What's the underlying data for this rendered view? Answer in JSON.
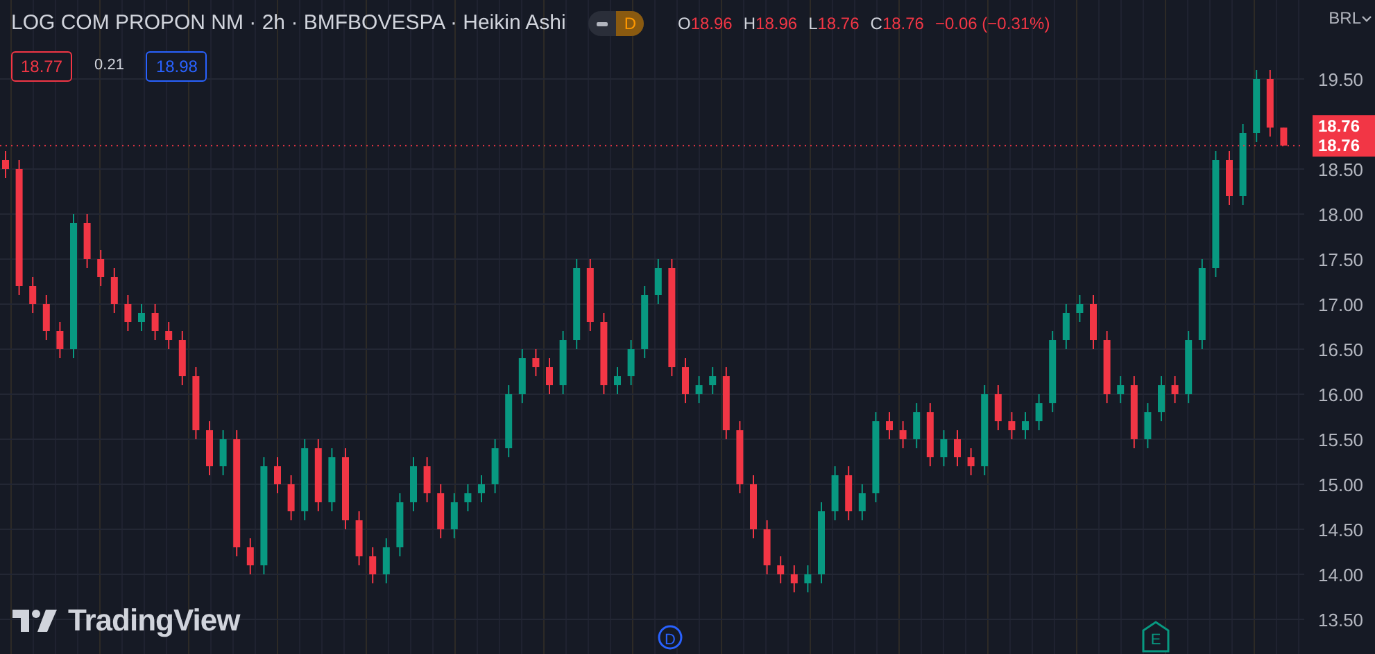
{
  "header": {
    "title": "LOG COM PROPON NM · 2h · BMFBOVESPA · Heikin Ashi",
    "badge": "D",
    "ohlc": [
      {
        "label": "O",
        "value": "18.96"
      },
      {
        "label": "H",
        "value": "18.96"
      },
      {
        "label": "L",
        "value": "18.76"
      },
      {
        "label": "C",
        "value": "18.76"
      }
    ],
    "change": "−0.06 (−0.31%)"
  },
  "trade": {
    "sell": "18.77",
    "spread": "0.21",
    "buy": "18.98"
  },
  "currency": "BRL",
  "price_labels": [
    "18.76"
  ],
  "logo": "TradingView",
  "events": [
    {
      "kind": "dividend",
      "label": "D",
      "color": "#2962ff"
    },
    {
      "kind": "earnings",
      "label": "E",
      "color": "#089981"
    }
  ],
  "chart_data": {
    "type": "candlestick",
    "grid": true,
    "yticks": [
      {
        "value": 13.5,
        "label": "13.50"
      },
      {
        "value": 14,
        "label": "14.00"
      },
      {
        "value": 14.5,
        "label": "14.50"
      },
      {
        "value": 15,
        "label": "15.00"
      },
      {
        "value": 15.5,
        "label": "15.50"
      },
      {
        "value": 16,
        "label": "16.00"
      },
      {
        "value": 16.5,
        "label": "16.50"
      },
      {
        "value": 17,
        "label": "17.00"
      },
      {
        "value": 17.5,
        "label": "17.50"
      },
      {
        "value": 18,
        "label": "18.00"
      },
      {
        "value": 18.5,
        "label": "18.50"
      },
      {
        "value": 19.5,
        "label": "19.50"
      }
    ],
    "ylim": [
      13.5,
      19.5
    ],
    "ref_lines": [
      {
        "axis": "y",
        "value": 18.76,
        "label": "18.76",
        "color": "#f23645"
      }
    ],
    "ohlc": [
      [
        18.6,
        18.7,
        18.4,
        18.5
      ],
      [
        18.5,
        18.6,
        17.1,
        17.2
      ],
      [
        17.2,
        17.3,
        16.9,
        17.0
      ],
      [
        17.0,
        17.1,
        16.6,
        16.7
      ],
      [
        16.7,
        16.8,
        16.4,
        16.5
      ],
      [
        16.5,
        18.0,
        16.4,
        17.9
      ],
      [
        17.9,
        18.0,
        17.4,
        17.5
      ],
      [
        17.5,
        17.6,
        17.2,
        17.3
      ],
      [
        17.3,
        17.4,
        16.9,
        17.0
      ],
      [
        17.0,
        17.1,
        16.7,
        16.8
      ],
      [
        16.8,
        17.0,
        16.7,
        16.9
      ],
      [
        16.9,
        17.0,
        16.6,
        16.7
      ],
      [
        16.7,
        16.8,
        16.5,
        16.6
      ],
      [
        16.6,
        16.7,
        16.1,
        16.2
      ],
      [
        16.2,
        16.3,
        15.5,
        15.6
      ],
      [
        15.6,
        15.7,
        15.1,
        15.2
      ],
      [
        15.2,
        15.6,
        15.1,
        15.5
      ],
      [
        15.5,
        15.6,
        14.2,
        14.3
      ],
      [
        14.3,
        14.4,
        14.0,
        14.1
      ],
      [
        14.1,
        15.3,
        14.0,
        15.2
      ],
      [
        15.2,
        15.3,
        14.9,
        15.0
      ],
      [
        15.0,
        15.1,
        14.6,
        14.7
      ],
      [
        14.7,
        15.5,
        14.6,
        15.4
      ],
      [
        15.4,
        15.5,
        14.7,
        14.8
      ],
      [
        14.8,
        15.4,
        14.7,
        15.3
      ],
      [
        15.3,
        15.4,
        14.5,
        14.6
      ],
      [
        14.6,
        14.7,
        14.1,
        14.2
      ],
      [
        14.2,
        14.3,
        13.9,
        14.0
      ],
      [
        14.0,
        14.4,
        13.9,
        14.3
      ],
      [
        14.3,
        14.9,
        14.2,
        14.8
      ],
      [
        14.8,
        15.3,
        14.7,
        15.2
      ],
      [
        15.2,
        15.3,
        14.8,
        14.9
      ],
      [
        14.9,
        15.0,
        14.4,
        14.5
      ],
      [
        14.5,
        14.9,
        14.4,
        14.8
      ],
      [
        14.8,
        15.0,
        14.7,
        14.9
      ],
      [
        14.9,
        15.1,
        14.8,
        15.0
      ],
      [
        15.0,
        15.5,
        14.9,
        15.4
      ],
      [
        15.4,
        16.1,
        15.3,
        16.0
      ],
      [
        16.0,
        16.5,
        15.9,
        16.4
      ],
      [
        16.4,
        16.5,
        16.2,
        16.3
      ],
      [
        16.3,
        16.4,
        16.0,
        16.1
      ],
      [
        16.1,
        16.7,
        16.0,
        16.6
      ],
      [
        16.6,
        17.5,
        16.5,
        17.4
      ],
      [
        17.4,
        17.5,
        16.7,
        16.8
      ],
      [
        16.8,
        16.9,
        16.0,
        16.1
      ],
      [
        16.1,
        16.3,
        16.0,
        16.2
      ],
      [
        16.2,
        16.6,
        16.1,
        16.5
      ],
      [
        16.5,
        17.2,
        16.4,
        17.1
      ],
      [
        17.1,
        17.5,
        17.0,
        17.4
      ],
      [
        17.4,
        17.5,
        16.2,
        16.3
      ],
      [
        16.3,
        16.4,
        15.9,
        16.0
      ],
      [
        16.0,
        16.2,
        15.9,
        16.1
      ],
      [
        16.1,
        16.3,
        16.0,
        16.2
      ],
      [
        16.2,
        16.3,
        15.5,
        15.6
      ],
      [
        15.6,
        15.7,
        14.9,
        15.0
      ],
      [
        15.0,
        15.1,
        14.4,
        14.5
      ],
      [
        14.5,
        14.6,
        14.0,
        14.1
      ],
      [
        14.1,
        14.2,
        13.9,
        14.0
      ],
      [
        14.0,
        14.1,
        13.8,
        13.9
      ],
      [
        13.9,
        14.1,
        13.8,
        14.0
      ],
      [
        14.0,
        14.8,
        13.9,
        14.7
      ],
      [
        14.7,
        15.2,
        14.6,
        15.1
      ],
      [
        15.1,
        15.2,
        14.6,
        14.7
      ],
      [
        14.7,
        15.0,
        14.6,
        14.9
      ],
      [
        14.9,
        15.8,
        14.8,
        15.7
      ],
      [
        15.7,
        15.8,
        15.5,
        15.6
      ],
      [
        15.6,
        15.7,
        15.4,
        15.5
      ],
      [
        15.5,
        15.9,
        15.4,
        15.8
      ],
      [
        15.8,
        15.9,
        15.2,
        15.3
      ],
      [
        15.3,
        15.6,
        15.2,
        15.5
      ],
      [
        15.5,
        15.6,
        15.2,
        15.3
      ],
      [
        15.3,
        15.4,
        15.1,
        15.2
      ],
      [
        15.2,
        16.1,
        15.1,
        16.0
      ],
      [
        16.0,
        16.1,
        15.6,
        15.7
      ],
      [
        15.7,
        15.8,
        15.5,
        15.6
      ],
      [
        15.6,
        15.8,
        15.5,
        15.7
      ],
      [
        15.7,
        16.0,
        15.6,
        15.9
      ],
      [
        15.9,
        16.7,
        15.8,
        16.6
      ],
      [
        16.6,
        17.0,
        16.5,
        16.9
      ],
      [
        16.9,
        17.1,
        16.8,
        17.0
      ],
      [
        17.0,
        17.1,
        16.5,
        16.6
      ],
      [
        16.6,
        16.7,
        15.9,
        16.0
      ],
      [
        16.0,
        16.2,
        15.9,
        16.1
      ],
      [
        16.1,
        16.2,
        15.4,
        15.5
      ],
      [
        15.5,
        15.9,
        15.4,
        15.8
      ],
      [
        15.8,
        16.2,
        15.7,
        16.1
      ],
      [
        16.1,
        16.2,
        15.9,
        16.0
      ],
      [
        16.0,
        16.7,
        15.9,
        16.6
      ],
      [
        16.6,
        17.5,
        16.5,
        17.4
      ],
      [
        17.4,
        18.7,
        17.3,
        18.6
      ],
      [
        18.6,
        18.7,
        18.1,
        18.2
      ],
      [
        18.2,
        19.0,
        18.1,
        18.9
      ],
      [
        18.9,
        19.6,
        18.8,
        19.5
      ],
      [
        19.5,
        19.6,
        18.86,
        18.96
      ],
      [
        18.96,
        18.96,
        18.76,
        18.76
      ]
    ]
  }
}
